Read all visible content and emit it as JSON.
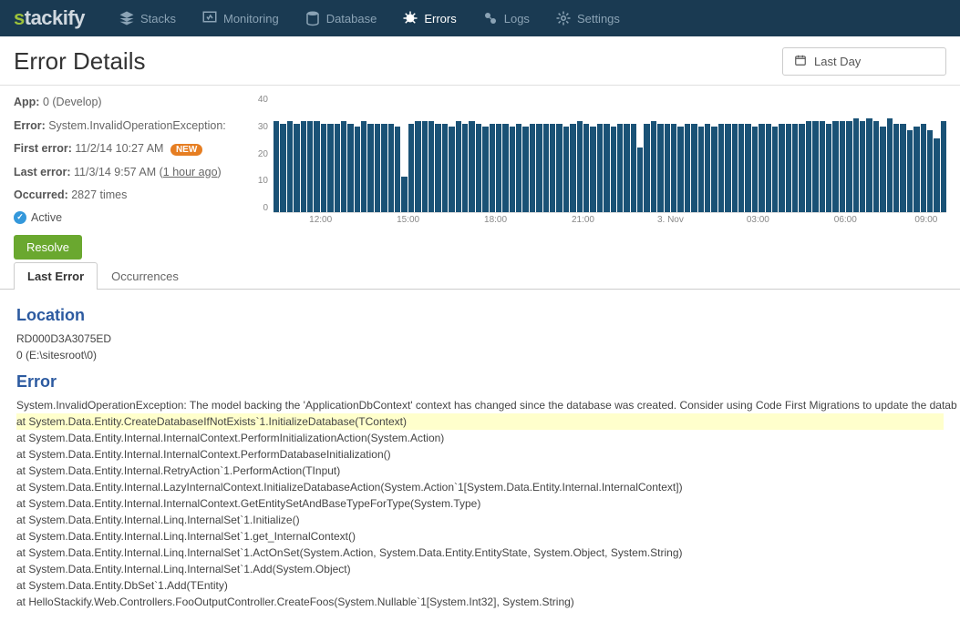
{
  "brand": {
    "s": "s",
    "rest": "tackify"
  },
  "nav": [
    {
      "label": "Stacks",
      "active": false
    },
    {
      "label": "Monitoring",
      "active": false
    },
    {
      "label": "Database",
      "active": false
    },
    {
      "label": "Errors",
      "active": true
    },
    {
      "label": "Logs",
      "active": false
    },
    {
      "label": "Settings",
      "active": false
    }
  ],
  "page_title": "Error Details",
  "date_range": "Last Day",
  "meta": {
    "app_label": "App:",
    "app_value": "0 (Develop)",
    "error_label": "Error:",
    "error_value": "System.InvalidOperationException:",
    "first_label": "First error:",
    "first_value": "11/2/14 10:27 AM",
    "new_badge": "NEW",
    "last_label": "Last error:",
    "last_value_a": "11/3/14 9:57 AM (",
    "last_value_b": "1 hour ago",
    "last_value_c": ")",
    "occurred_label": "Occurred:",
    "occurred_value": "2827 times",
    "active_label": "Active",
    "resolve": "Resolve"
  },
  "tabs": {
    "t0": "Last Error",
    "t1": "Occurrences"
  },
  "detail": {
    "location_h": "Location",
    "location_1": "RD000D3A3075ED",
    "location_2": "0 (E:\\sitesroot\\0)",
    "error_h": "Error",
    "msg": "System.InvalidOperationException: The model backing the 'ApplicationDbContext' context has changed since the database was created. Consider using Code First Migrations to update the datab",
    "stack": [
      "   at System.Data.Entity.CreateDatabaseIfNotExists`1.InitializeDatabase(TContext)",
      "   at System.Data.Entity.Internal.InternalContext.PerformInitializationAction(System.Action)",
      "   at System.Data.Entity.Internal.InternalContext.PerformDatabaseInitialization()",
      "   at System.Data.Entity.Internal.RetryAction`1.PerformAction(TInput)",
      "   at System.Data.Entity.Internal.LazyInternalContext.InitializeDatabaseAction(System.Action`1[System.Data.Entity.Internal.InternalContext])",
      "   at System.Data.Entity.Internal.InternalContext.GetEntitySetAndBaseTypeForType(System.Type)",
      "   at System.Data.Entity.Internal.Linq.InternalSet`1.Initialize()",
      "   at System.Data.Entity.Internal.Linq.InternalSet`1.get_InternalContext()",
      "   at System.Data.Entity.Internal.Linq.InternalSet`1.ActOnSet(System.Action, System.Data.Entity.EntityState, System.Object, System.String)",
      "   at System.Data.Entity.Internal.Linq.InternalSet`1.Add(System.Object)",
      "   at System.Data.Entity.DbSet`1.Add(TEntity)",
      "   at HelloStackify.Web.Controllers.FooOutputController.CreateFoos(System.Nullable`1[System.Int32], System.String)"
    ]
  },
  "chart_data": {
    "type": "bar",
    "ylabel": "",
    "xlabel": "",
    "ylim": [
      0,
      40
    ],
    "y_ticks": [
      "40",
      "30",
      "20",
      "10",
      "0"
    ],
    "x_ticks": [
      {
        "pos": 7,
        "label": "12:00"
      },
      {
        "pos": 20,
        "label": "15:00"
      },
      {
        "pos": 33,
        "label": "18:00"
      },
      {
        "pos": 46,
        "label": "21:00"
      },
      {
        "pos": 59,
        "label": "3. Nov"
      },
      {
        "pos": 72,
        "label": "03:00"
      },
      {
        "pos": 85,
        "label": "06:00"
      },
      {
        "pos": 97,
        "label": "09:00"
      }
    ],
    "values": [
      31,
      30,
      31,
      30,
      31,
      31,
      31,
      30,
      30,
      30,
      31,
      30,
      29,
      31,
      30,
      30,
      30,
      30,
      29,
      12,
      30,
      31,
      31,
      31,
      30,
      30,
      29,
      31,
      30,
      31,
      30,
      29,
      30,
      30,
      30,
      29,
      30,
      29,
      30,
      30,
      30,
      30,
      30,
      29,
      30,
      31,
      30,
      29,
      30,
      30,
      29,
      30,
      30,
      30,
      22,
      30,
      31,
      30,
      30,
      30,
      29,
      30,
      30,
      29,
      30,
      29,
      30,
      30,
      30,
      30,
      30,
      29,
      30,
      30,
      29,
      30,
      30,
      30,
      30,
      31,
      31,
      31,
      30,
      31,
      31,
      31,
      32,
      31,
      32,
      31,
      29,
      32,
      30,
      30,
      28,
      29,
      30,
      28,
      25,
      31
    ]
  }
}
